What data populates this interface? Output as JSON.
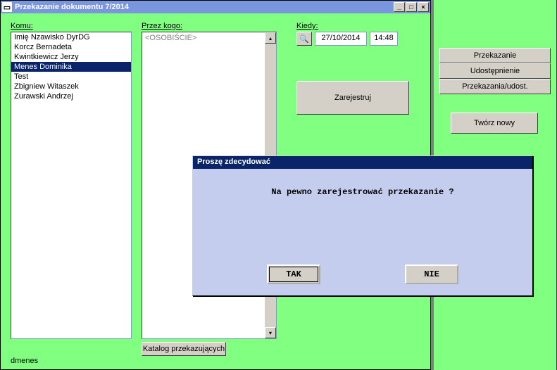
{
  "window": {
    "title": "Przekazanie dokumentu   7/2014"
  },
  "labels": {
    "komu": "Komu:",
    "przez": "Przez kogo:",
    "kiedy": "Kiedy:"
  },
  "komu_list": [
    "Imię Nzawisko DyrDG",
    "Korcz Bernadeta",
    "Kwintkiewicz Jerzy",
    "Menes Dominika",
    "Test",
    "Zbigniew Witaszek",
    "Zurawski Andrzej"
  ],
  "komu_selected_index": 3,
  "przez_value": "<OSOBIŚCIE>",
  "date": "27/10/2014",
  "time": "14:48",
  "buttons": {
    "zarejestruj": "Zarejestruj",
    "katalog": "Katalog przekazujących",
    "przekazanie": "Przekazanie",
    "udostepnienie": "Udostępnienie",
    "przek_udost": "Przekazania/udost.",
    "tworz_nowy": "Twórz nowy"
  },
  "status": "dmenes",
  "dialog": {
    "title": "Proszę zdecydować",
    "message": "Na pewno zarejestrować przekazanie ?",
    "yes": "TAK",
    "no": "NIE"
  }
}
